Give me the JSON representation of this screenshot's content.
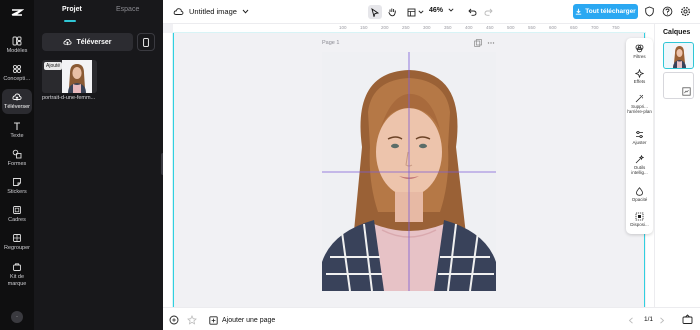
{
  "rail": {
    "items": [
      {
        "label": "Modèles",
        "icon": "templates-icon"
      },
      {
        "label": "Concepti…",
        "icon": "design-icon"
      },
      {
        "label": "Téléverser",
        "icon": "upload-cloud-icon"
      },
      {
        "label": "Texte",
        "icon": "text-icon"
      },
      {
        "label": "Formes",
        "icon": "shapes-icon"
      },
      {
        "label": "Stickers",
        "icon": "sticker-icon"
      },
      {
        "label": "Cadres",
        "icon": "frame-icon"
      },
      {
        "label": "Regrouper",
        "icon": "group-icon"
      },
      {
        "label": "Kit de marque",
        "icon": "brand-kit-icon"
      }
    ],
    "active_index": 2
  },
  "panel": {
    "tabs": [
      "Projet",
      "Espace"
    ],
    "upload_label": "Téléverser",
    "asset_badge": "Ajouté",
    "asset_name": "portrait-d-une-femm..."
  },
  "topbar": {
    "title": "Untitled image",
    "zoom": "46%",
    "download_label": "Tout télécharger"
  },
  "canvas": {
    "page_label": "Page 1",
    "ruler_ticks": [
      "100",
      "150",
      "200",
      "250",
      "300",
      "350",
      "400",
      "450",
      "500",
      "550",
      "600",
      "650",
      "700",
      "750"
    ]
  },
  "tools_panel": [
    {
      "label": "Filtres",
      "icon": "filters-icon"
    },
    {
      "label": "Effets",
      "icon": "effects-icon"
    },
    {
      "label": "Suppri... l'arrière-plan",
      "icon": "remove-bg-icon"
    },
    {
      "label": "Ajuster",
      "icon": "adjust-icon"
    },
    {
      "label": "Outils intellig...",
      "icon": "smart-tools-icon"
    },
    {
      "label": "Opacité",
      "icon": "opacity-icon"
    },
    {
      "label": "Disposi...",
      "icon": "arrange-icon"
    }
  ],
  "layers": {
    "title": "Calques"
  },
  "bottombar": {
    "add_page_label": "Ajouter une page",
    "page_counter": "1/1"
  }
}
